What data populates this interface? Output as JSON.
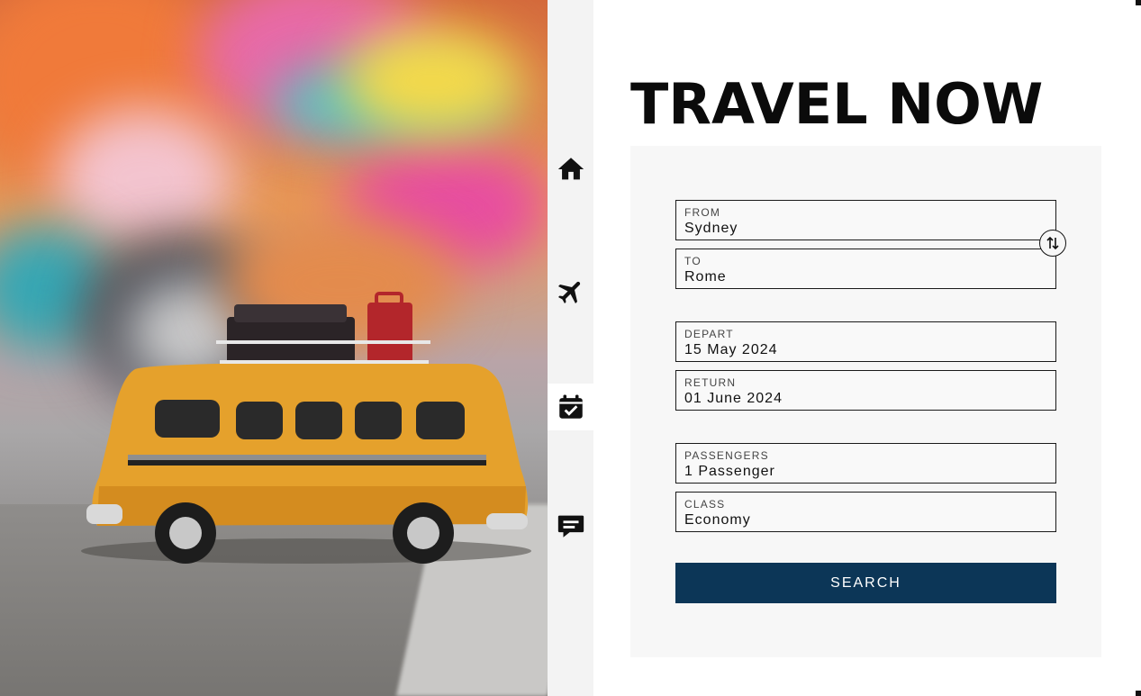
{
  "app": {
    "title": "TRAVEL NOW",
    "accent_color": "#0c3657"
  },
  "hero": {
    "icon": "photo-toy-bus",
    "alt": "Toy bus with luggage on roof"
  },
  "nav": {
    "items": [
      {
        "name": "home",
        "icon": "home-icon",
        "active": false
      },
      {
        "name": "flights",
        "icon": "airplane-icon",
        "active": false
      },
      {
        "name": "bookings",
        "icon": "calendar-check-icon",
        "active": true
      },
      {
        "name": "messages",
        "icon": "chat-icon",
        "active": false
      }
    ]
  },
  "form": {
    "from": {
      "label": "FROM",
      "value": "Sydney"
    },
    "to": {
      "label": "TO",
      "value": "Rome"
    },
    "depart": {
      "label": "DEPART",
      "value": "15 May 2024"
    },
    "return": {
      "label": "RETURN",
      "value": "01 June 2024"
    },
    "passengers": {
      "label": "PASSENGERS",
      "value": "1 Passenger"
    },
    "class": {
      "label": "CLASS",
      "value": "Economy"
    },
    "swap_icon": "swap-vertical-icon",
    "search_label": "SEARCH"
  }
}
